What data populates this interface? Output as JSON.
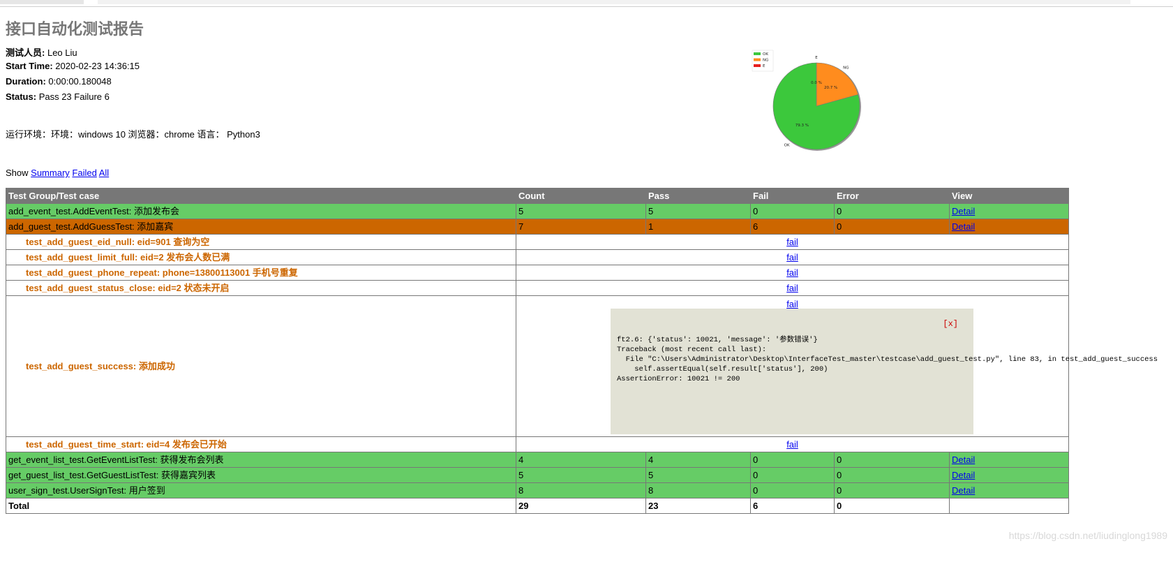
{
  "report": {
    "title": "接口自动化测试报告",
    "tester_label": "测试人员:",
    "tester": "Leo Liu",
    "start_label": "Start Time:",
    "start_time": "2020-02-23 14:36:15",
    "duration_label": "Duration:",
    "duration": "0:00:00.180048",
    "status_label": "Status:",
    "status": "Pass 23 Failure 6",
    "environment": "运行环境：环境：windows 10 浏览器：chrome 语言： Python3"
  },
  "show": {
    "label": "Show",
    "summary": "Summary",
    "failed": "Failed",
    "all": "All"
  },
  "chart_data": {
    "type": "pie",
    "slices": [
      {
        "label": "OK",
        "value": 79.3,
        "pct_text": "79.3 %",
        "color": "#3cc83c"
      },
      {
        "label": "NG",
        "value": 20.7,
        "pct_text": "20.7 %",
        "color": "#ff8c1e"
      },
      {
        "label": "E",
        "value": 0.0,
        "pct_text": "0.0 %",
        "color": "#e61e1e"
      }
    ],
    "legend": [
      "OK",
      "NG",
      "E"
    ],
    "legend_position": "top-left"
  },
  "table": {
    "headers": [
      "Test Group/Test case",
      "Count",
      "Pass",
      "Fail",
      "Error",
      "View"
    ],
    "groups": [
      {
        "name": "add_event_test.AddEventTest: 添加发布会",
        "count": "5",
        "pass": "5",
        "fail": "0",
        "error": "0",
        "view": "Detail"
      },
      {
        "name": "add_guest_test.AddGuessTest: 添加嘉宾",
        "count": "7",
        "pass": "1",
        "fail": "6",
        "error": "0",
        "view": "Detail"
      },
      {
        "name": "get_event_list_test.GetEventListTest: 获得发布会列表",
        "count": "4",
        "pass": "4",
        "fail": "0",
        "error": "0",
        "view": "Detail"
      },
      {
        "name": "get_guest_list_test.GetGuestListTest: 获得嘉宾列表",
        "count": "5",
        "pass": "5",
        "fail": "0",
        "error": "0",
        "view": "Detail"
      },
      {
        "name": "user_sign_test.UserSignTest: 用户签到",
        "count": "8",
        "pass": "8",
        "fail": "0",
        "error": "0",
        "view": "Detail"
      }
    ],
    "cases": [
      {
        "name": "test_add_guest_eid_null: eid=901 查询为空",
        "result": "fail"
      },
      {
        "name": "test_add_guest_limit_full: eid=2 发布会人数已满",
        "result": "fail"
      },
      {
        "name": "test_add_guest_phone_repeat: phone=13800113001 手机号重复",
        "result": "fail"
      },
      {
        "name": "test_add_guest_status_close: eid=2 状态未开启",
        "result": "fail"
      },
      {
        "name": "test_add_guest_success: 添加成功",
        "result": "fail"
      },
      {
        "name": "test_add_guest_time_start: eid=4 发布会已开始",
        "result": "fail"
      }
    ],
    "popup": {
      "close": "[x]",
      "lines": [
        "ft2.6: {'status': 10021, 'message': '参数错误'}",
        "Traceback (most recent call last):",
        "  File \"C:\\Users\\Administrator\\Desktop\\InterfaceTest_master\\testcase\\add_guest_test.py\", line 83, in test_add_guest_success",
        "    self.assertEqual(self.result['status'], 200)",
        "AssertionError: 10021 != 200"
      ]
    },
    "total": {
      "label": "Total",
      "count": "29",
      "pass": "23",
      "fail": "6",
      "error": "0",
      "view": ""
    }
  },
  "watermark": "https://blog.csdn.net/liudinglong1989"
}
